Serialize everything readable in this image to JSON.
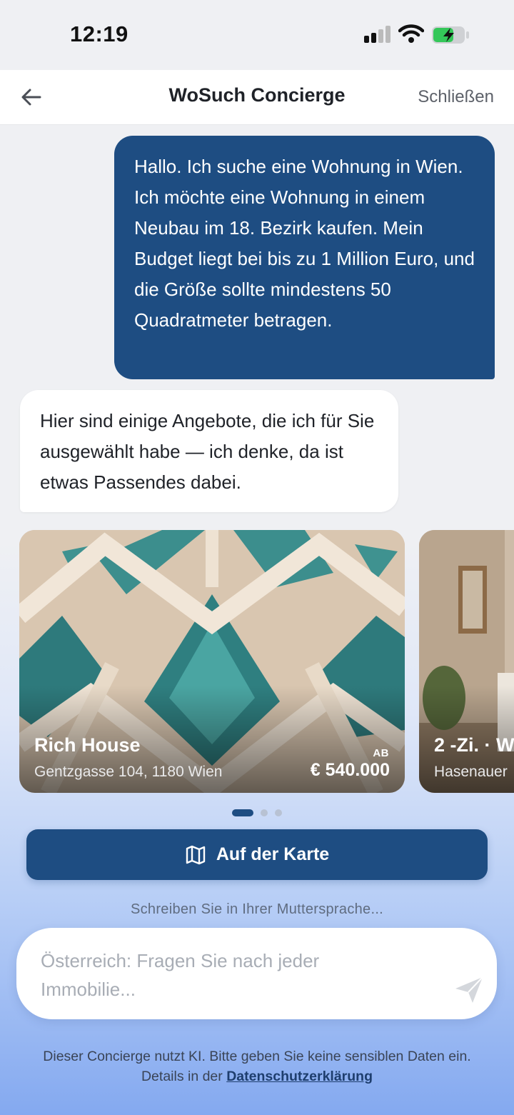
{
  "status_bar": {
    "time": "12:19"
  },
  "nav": {
    "title": "WoSuch Concierge",
    "close_label": "Schließen"
  },
  "messages": {
    "user": "Hallo. Ich suche eine Wohnung in Wien. Ich möchte eine Wohnung in einem Neubau im 18. Bezirk kaufen. Mein Budget liegt bei bis zu 1 Million Euro, und die Größe sollte mindestens 50 Quadratmeter betragen.",
    "bot": "Hier sind einige Angebote, die ich für Sie ausgewählt habe — ich denke, da ist etwas Passendes dabei."
  },
  "listings": [
    {
      "title": "Rich House",
      "address": "Gentzgasse 104, 1180 Wien",
      "price_prefix": "AB",
      "price": "€ 540.000"
    },
    {
      "title": "2 -Zi. · W",
      "address": "Hasenauer"
    }
  ],
  "carousel": {
    "active_index": 0,
    "count": 3
  },
  "map_button": {
    "label": "Auf der Karte",
    "icon": "map-icon"
  },
  "composer": {
    "hint": "Schreiben Sie in Ihrer Muttersprache...",
    "placeholder": "Österreich: Fragen Sie nach jeder Immobilie...",
    "send_icon": "send-icon"
  },
  "footer": {
    "text": "Dieser Concierge nutzt KI. Bitte geben Sie keine sensiblen Daten ein. Details in der",
    "link": "Datenschutzerklärung"
  },
  "colors": {
    "primary": "#1e4d82",
    "background": "#eff0f3",
    "battery_green": "#34c759"
  }
}
